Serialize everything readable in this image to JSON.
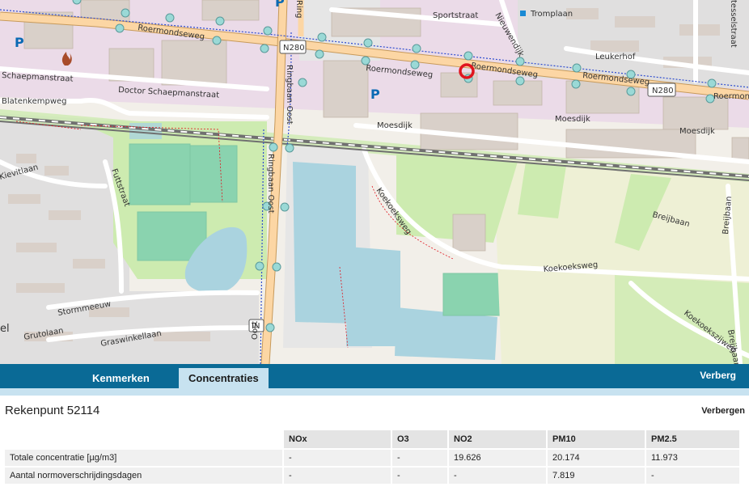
{
  "map": {
    "streets": {
      "sportstraat": "Sportstraat",
      "tromplaan": "Tromplaan",
      "roermondseweg_top": "Roermondseweg",
      "roermondseweg_mid": "Roermondseweg",
      "roermondseweg_mid2": "Roermondseweg",
      "roermondseweg_right": "Roermondseweg",
      "roermondseweg_far": "Roermonc",
      "n280_shield_1": "N280",
      "n280_shield_2": "N280",
      "schaepmanstraat": "Schaepmanstraat",
      "doctor_schaepmanstraat": "Doctor Schaepmanstraat",
      "blatenkempweg": "Blatenkempweg",
      "ringbaan_oost": "Ringbaan Oost",
      "ringbaan_oost_top": "Ring",
      "ringbaan_oost_bottom": "Oost",
      "moesdijk_left": "Moesdijk",
      "moesdijk_mid": "Moesdijk",
      "moesdijk_right": "Moesdijk",
      "neuwendijk": "Nieuwendijk",
      "leukerhof": "Leukerhof",
      "tesselstraat": "tesselstraat",
      "kievitlaan": "Kievitlaan",
      "futstraat": "Futtstraat",
      "koekoeksweg": "Koekoeksweg",
      "koekoeksweg_right": "Koekoeksweg",
      "koekoeksweg_diag": "Koekoekssweg",
      "breijbaan_top": "Breijbaan",
      "breijbaan_mid": "Breijbaan",
      "breijbaan_bottom": "Breijbaan",
      "stormmeeuw": "Stormmeeuw",
      "grutolaan": "Grutolaan",
      "graswinkellaan": "Graswinkellaan",
      "koekoekszijweg": "Koekoekszijweg",
      "in_shield": "IN",
      "parking": "P",
      "el": "el"
    }
  },
  "tabs": {
    "kenmerken": "Kenmerken",
    "concentraties": "Concentraties",
    "verberg": "Verberg"
  },
  "panel": {
    "title": "Rekenpunt 52114",
    "hide": "Verbergen",
    "columns": [
      "",
      "NOx",
      "O3",
      "NO2",
      "PM10",
      "PM2.5"
    ],
    "rows": [
      {
        "label": "Totale concentratie [µg/m3]",
        "values": [
          "-",
          "-",
          "19.626",
          "20.174",
          "11.973"
        ]
      },
      {
        "label": "Aantal normoverschrijdingsdagen",
        "values": [
          "-",
          "-",
          "-",
          "7.819",
          "-"
        ]
      }
    ]
  },
  "colors": {
    "brand": "#0a6a96",
    "active_tab": "#c7e2f0",
    "road_main": "#fcd6a4",
    "water": "#aad3df",
    "grass": "#cdebb0",
    "residential": "#e0dfdf",
    "industrial": "#ebdbe8",
    "marker": "#e0141e"
  },
  "icons": [
    "calculation-point-marker-icon",
    "parking-icon",
    "fire-station-icon",
    "bus-stop-icon"
  ]
}
